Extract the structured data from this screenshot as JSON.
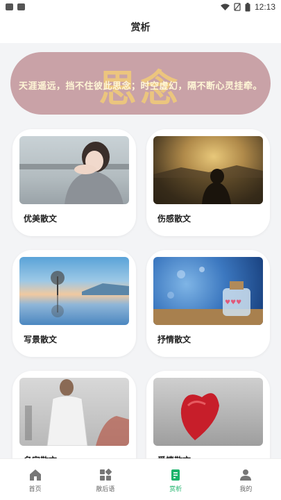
{
  "status_bar": {
    "time": "12:13"
  },
  "header": {
    "title": "赏析"
  },
  "banner": {
    "big_text": "思念",
    "poem": "天涯遥远，挡不住彼此思念；时空虚幻，隔不断心灵挂牵。"
  },
  "cards": [
    {
      "label": "优美散文",
      "image": "girl-leaning-on-railing-photo"
    },
    {
      "label": "伤感散文",
      "image": "person-sitting-by-lake-at-dusk-photo"
    },
    {
      "label": "写景散文",
      "image": "tree-reflection-lake-landscape-photo"
    },
    {
      "label": "抒情散文",
      "image": "glass-bottle-of-hearts-photo"
    },
    {
      "label": "名家散文",
      "image": "man-in-traditional-robe-photo"
    },
    {
      "label": "爱情散文",
      "image": "red-knitted-heart-photo"
    }
  ],
  "tabs": [
    {
      "label": "首页",
      "icon": "home-icon",
      "active": false
    },
    {
      "label": "散后语",
      "icon": "apps-grid-icon",
      "active": false
    },
    {
      "label": "赏析",
      "icon": "document-icon",
      "active": true
    },
    {
      "label": "我的",
      "icon": "person-icon",
      "active": false
    }
  ],
  "colors": {
    "accent": "#1bb36a",
    "banner_bg": "#c9a2a7",
    "banner_text": "#f2cc77",
    "page_bg": "#f3f4f6"
  }
}
